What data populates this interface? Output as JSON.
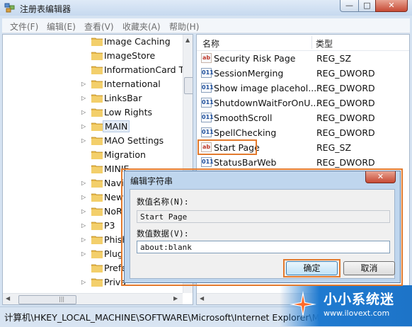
{
  "window": {
    "title": "注册表编辑器",
    "min_glyph": "—",
    "max_glyph": "□",
    "close_glyph": "✕"
  },
  "menu": [
    "文件(F)",
    "编辑(E)",
    "查看(V)",
    "收藏夹(A)",
    "帮助(H)"
  ],
  "tree": {
    "items": [
      {
        "label": "Image Caching",
        "expandable": false
      },
      {
        "label": "ImageStore",
        "expandable": false
      },
      {
        "label": "InformationCard T",
        "expandable": false
      },
      {
        "label": "International",
        "expandable": true
      },
      {
        "label": "LinksBar",
        "expandable": true
      },
      {
        "label": "Low Rights",
        "expandable": true
      },
      {
        "label": "MAIN",
        "expandable": true,
        "selected": true
      },
      {
        "label": "MAO Settings",
        "expandable": true
      },
      {
        "label": "Migration",
        "expandable": false
      },
      {
        "label": "MINIE",
        "expandable": false
      },
      {
        "label": "Navi",
        "expandable": true
      },
      {
        "label": "New",
        "expandable": true
      },
      {
        "label": "NoR",
        "expandable": true
      },
      {
        "label": "P3",
        "expandable": true
      },
      {
        "label": "Phish",
        "expandable": true
      },
      {
        "label": "Plug",
        "expandable": true
      },
      {
        "label": "Prefe",
        "expandable": false
      },
      {
        "label": "Priva",
        "expandable": true
      }
    ]
  },
  "values_pane": {
    "col_name": "名称",
    "col_type": "类型",
    "rows": [
      {
        "name": "Security Risk Page",
        "type": "REG_SZ",
        "icon": "string-value-icon"
      },
      {
        "name": "SessionMerging",
        "type": "REG_DWORD",
        "icon": "dword-value-icon"
      },
      {
        "name": "Show image placehol...",
        "type": "REG_DWORD",
        "icon": "dword-value-icon"
      },
      {
        "name": "ShutdownWaitForOnU...",
        "type": "REG_DWORD",
        "icon": "dword-value-icon"
      },
      {
        "name": "SmoothScroll",
        "type": "REG_DWORD",
        "icon": "dword-value-icon"
      },
      {
        "name": "SpellChecking",
        "type": "REG_DWORD",
        "icon": "dword-value-icon"
      },
      {
        "name": "Start Page",
        "type": "REG_SZ",
        "icon": "string-value-icon",
        "highlighted": true
      },
      {
        "name": "StatusBarWeb",
        "type": "REG_DWORD",
        "icon": "dword-value-icon"
      }
    ]
  },
  "status_bar": {
    "path": "计算机\\HKEY_LOCAL_MACHINE\\SOFTWARE\\Microsoft\\Internet Explorer\\MAIN"
  },
  "dialog": {
    "title": "编辑字符串",
    "value_name_label": "数值名称(N):",
    "value_name": "Start Page",
    "value_data_label": "数值数据(V):",
    "value_data": "about:blank",
    "ok_label": "确定",
    "cancel_label": "取消",
    "close_glyph": "✕"
  },
  "watermark": {
    "title": "小小系统迷",
    "url": "www.ilovext.com"
  },
  "colors": {
    "highlight": "#e27a2d",
    "watermark_bg": "#1d74c8"
  }
}
